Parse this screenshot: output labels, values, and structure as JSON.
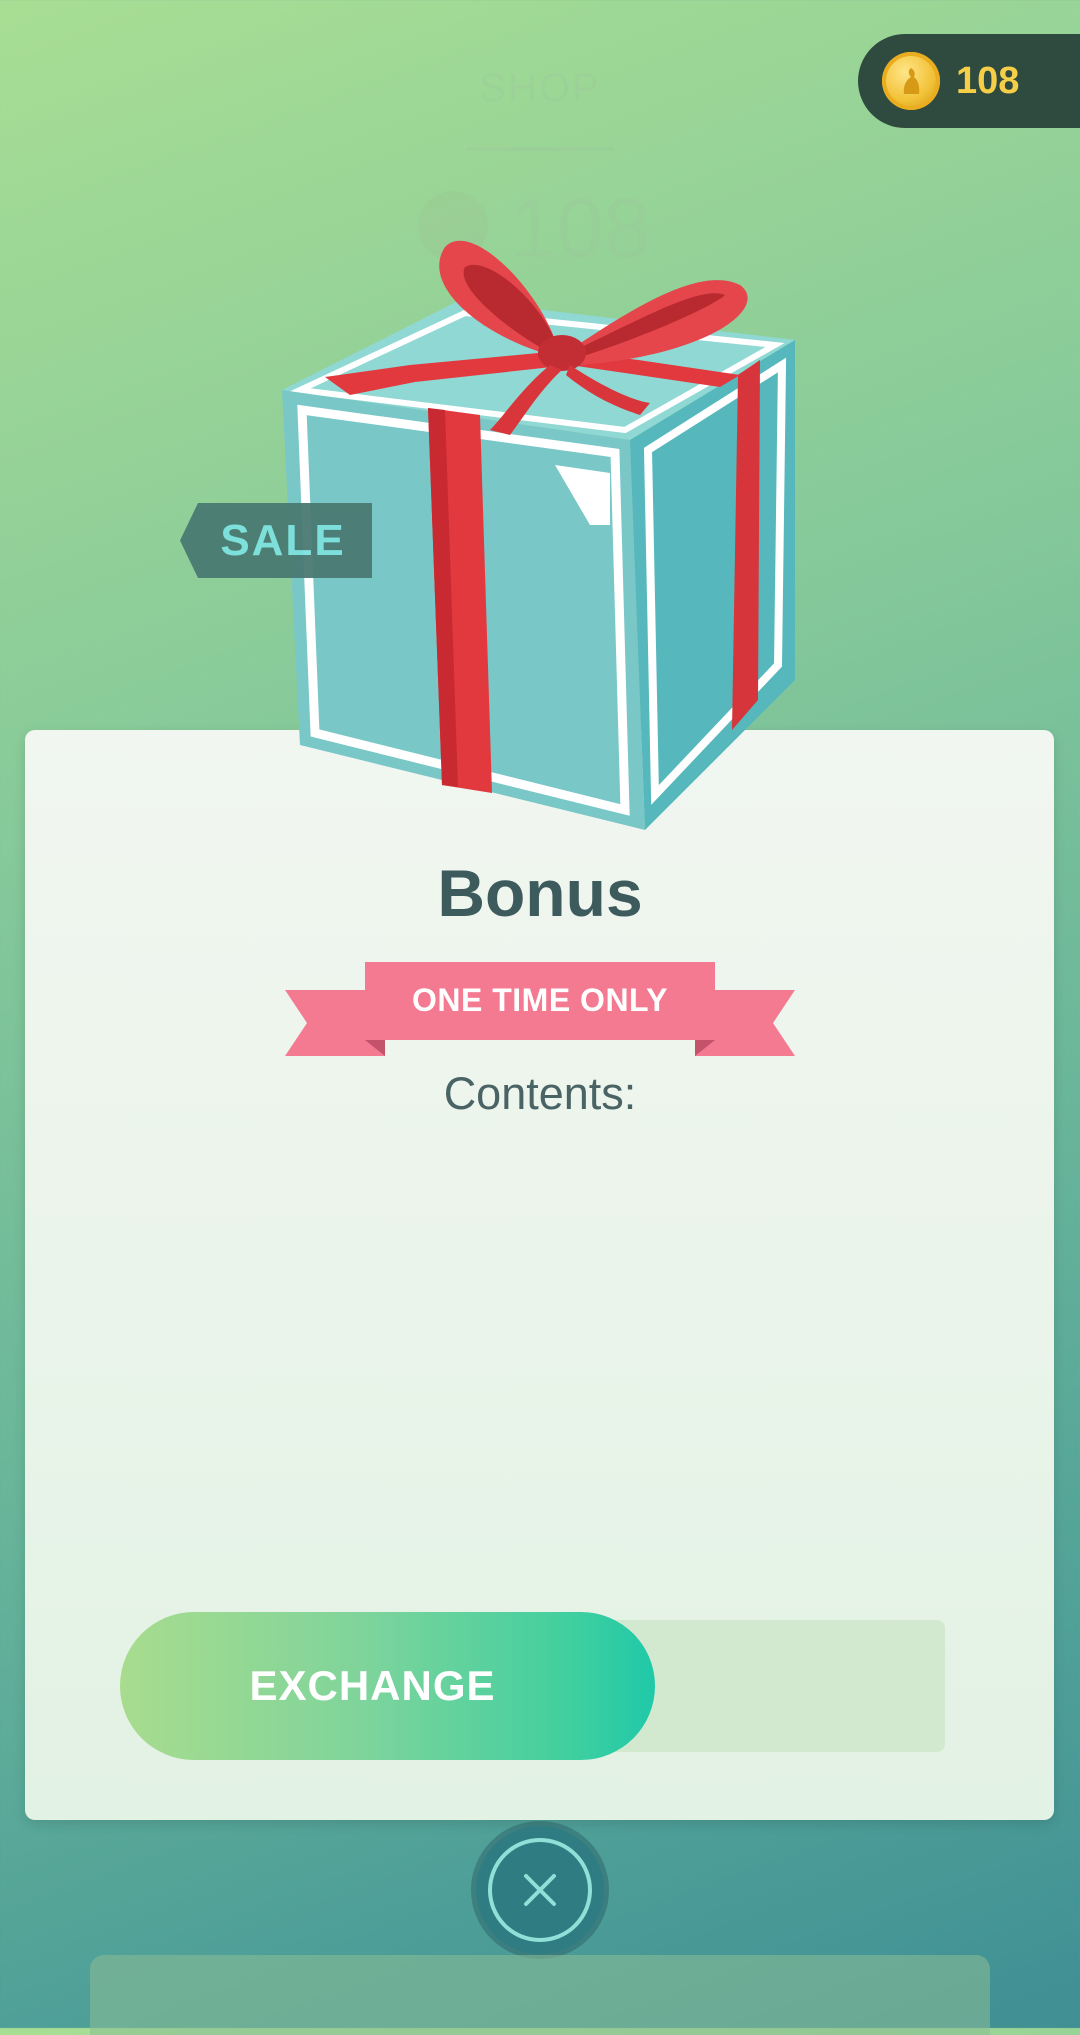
{
  "background": {
    "shop_title": "SHOP",
    "balance": "108"
  },
  "coins": {
    "amount": "108",
    "icon": "pokecoin-icon"
  },
  "item": {
    "sale_label": "SALE",
    "title": "Bonus",
    "badge": "ONE TIME ONLY",
    "contents_label": "Contents:"
  },
  "actions": {
    "exchange_label": "EXCHANGE",
    "close_icon": "close-icon"
  },
  "colors": {
    "badge": "#f47a92",
    "coin_text": "#f5cf47",
    "box": "#7fd1cf",
    "ribbon": "#e2393f"
  }
}
